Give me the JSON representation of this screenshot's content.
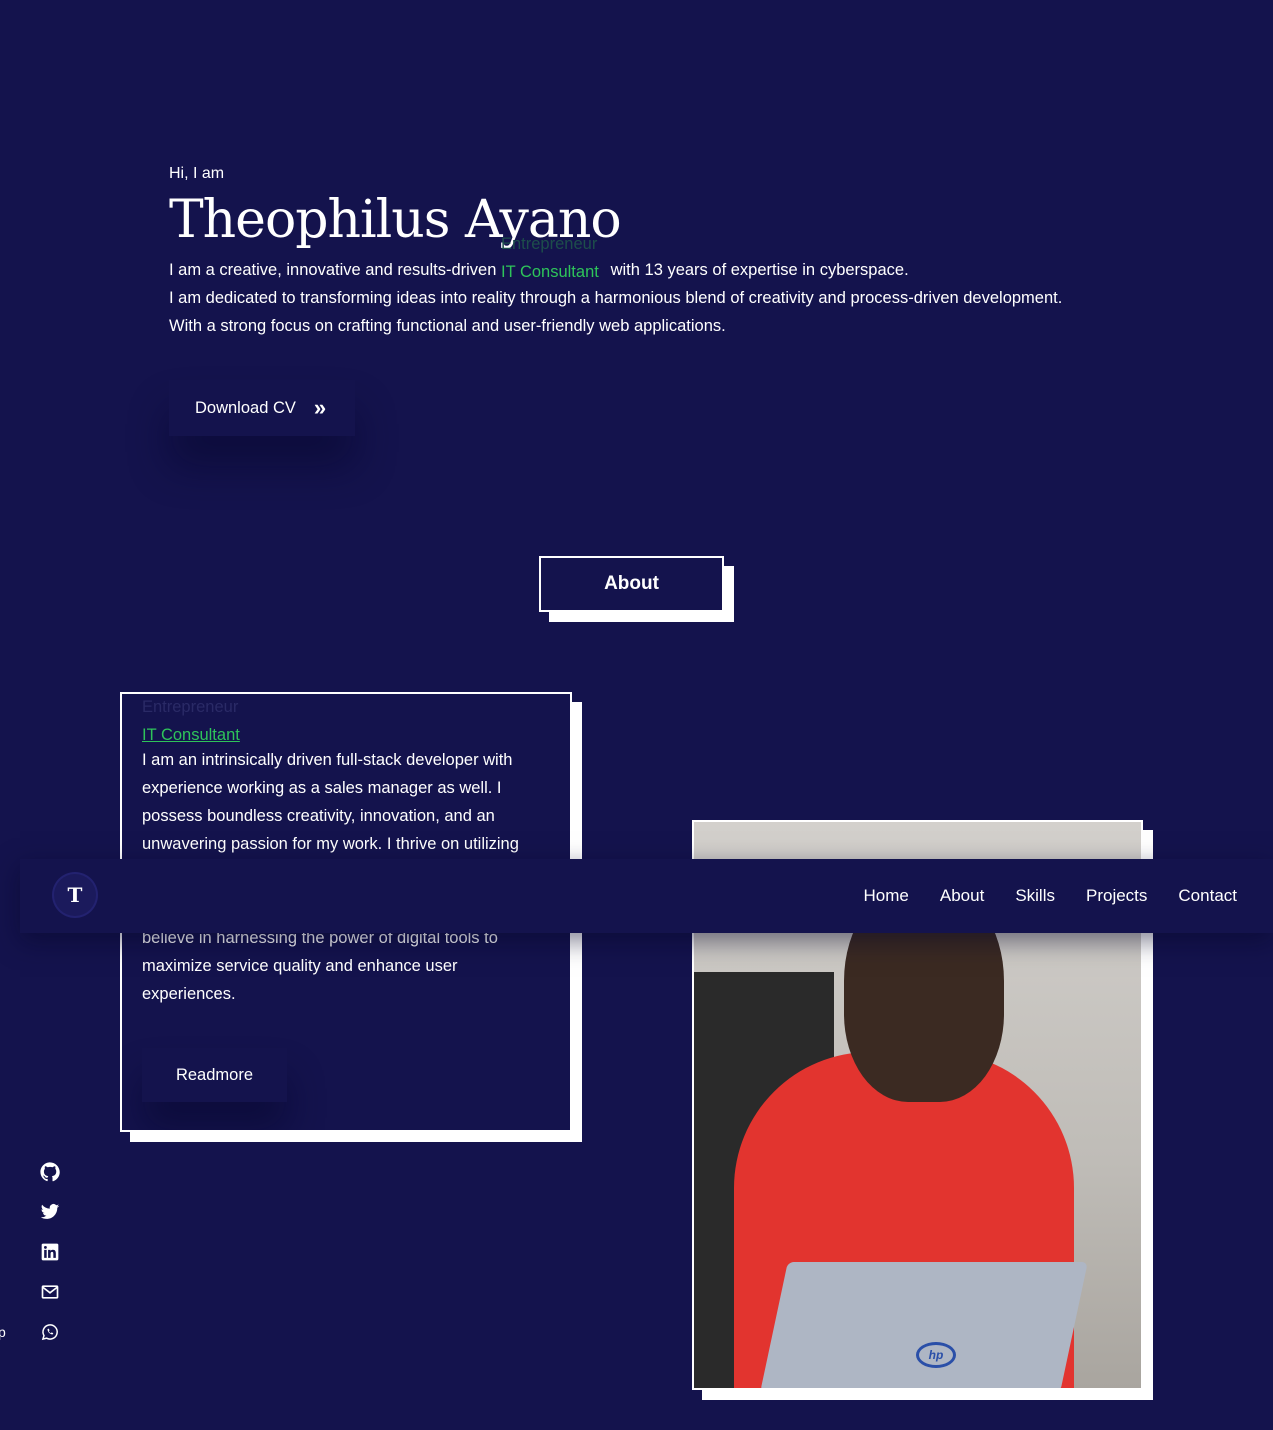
{
  "hero": {
    "greeting": "Hi, I am",
    "name": "Theophilus Ayano",
    "intro_before": "I am a creative, innovative and results-driven",
    "role_faded": "Entrepreneur",
    "role_active": "IT Consultant",
    "intro_after": "with 13 years of expertise in cyberspace.",
    "line2": "I am dedicated to transforming ideas into reality through a harmonious blend of creativity and process-driven development.",
    "line3": "With a strong focus on crafting functional and user-friendly web applications.",
    "cv_button": "Download CV",
    "cv_arrow": "»"
  },
  "about": {
    "heading": "About",
    "role_faded": "Entrepreneur",
    "role_active": "IT Consultant",
    "paragraph_top": [
      "I am an intrinsically driven full-stack developer with",
      "experience working as a sales manager as well. I",
      "possess boundless creativity, innovation, and an",
      "unwavering passion for my work. I thrive on utilizing"
    ],
    "paragraph_bottom": [
      "believe in harnessing the power of digital tools to",
      "maximize service quality and enhance user",
      "experiences."
    ],
    "readmore": "Readmore"
  },
  "nav": {
    "logo_letter": "T",
    "links": [
      "Home",
      "About",
      "Skills",
      "Projects",
      "Contact"
    ]
  },
  "social": {
    "icons": [
      "github-icon",
      "twitter-icon",
      "linkedin-icon",
      "mail-icon",
      "whatsapp-icon"
    ],
    "edge_text": "p"
  },
  "colors": {
    "background": "#14134d",
    "accent_green": "#2ec45a",
    "text": "#ffffff"
  }
}
